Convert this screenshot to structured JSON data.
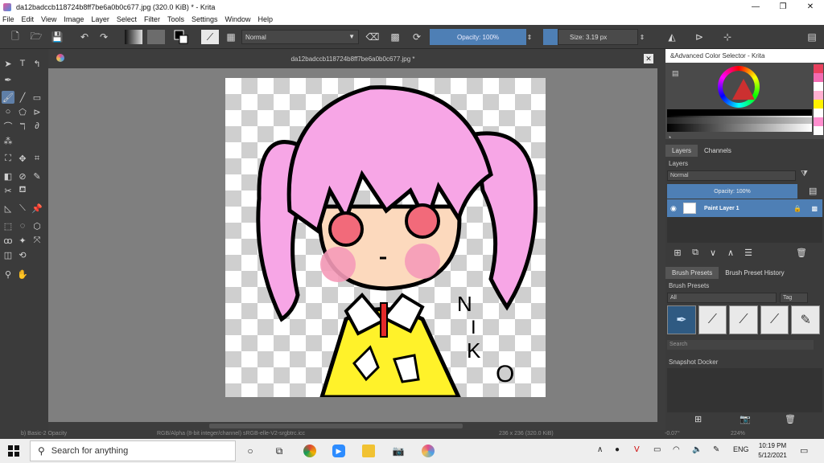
{
  "window": {
    "title": "da12badccb118724b8ff7be6a0b0c677.jpg (320.0 KiB)  * - Krita",
    "minimize": "—",
    "maximize": "❐",
    "close": "✕"
  },
  "menu": [
    "File",
    "Edit",
    "View",
    "Image",
    "Layer",
    "Select",
    "Filter",
    "Tools",
    "Settings",
    "Window",
    "Help"
  ],
  "toolbar": {
    "blend_mode": "Normal",
    "opacity": "Opacity: 100%",
    "size": "Size: 3.19 px"
  },
  "document_tab": {
    "title": "da12badccb118724b8ff7be6a0b0c677.jpg *"
  },
  "canvas_text": {
    "handwriting_n": "N",
    "handwriting_i": "I",
    "handwriting_k": "K",
    "handwriting_o": "O"
  },
  "right_panel": {
    "advanced_color_selector_title": "&Advanced Color Selector - Krita",
    "color_swatches": [
      "#e8405d",
      "#f26bb1",
      "#ffffff",
      "#ffb0d0",
      "#fff200",
      "#ffffff",
      "#ff8fcf",
      "#fefefe"
    ],
    "tabs": [
      {
        "label": "Layers",
        "active": true
      },
      {
        "label": "Channels",
        "active": false
      }
    ],
    "layers_label": "Layers",
    "layer_blend_mode": "Normal",
    "layer_opacity": "Opacity:  100%",
    "layer_name": "Paint Layer 1",
    "preset_tabs": [
      {
        "label": "Brush Presets",
        "active": true
      },
      {
        "label": "Brush Preset History",
        "active": false
      }
    ],
    "brush_presets_label": "Brush Presets",
    "preset_filter": "All",
    "tag_label": "Tag",
    "search_placeholder": "Search",
    "snapshot_docker_label": "Snapshot Docker"
  },
  "status": {
    "brush": "b) Basic-2 Opacity",
    "color_space": "RGB/Alpha (8-bit integer/channel)  sRGB-elle-V2-srgbtrc.icc",
    "dimensions": "236 x 236 (320.0 KiB)",
    "rotation": "-0.07°",
    "zoom": "224%"
  },
  "taskbar": {
    "search_placeholder": "Search for anything",
    "language": "ENG",
    "time": "10:19 PM",
    "date": "5/12/2021"
  }
}
